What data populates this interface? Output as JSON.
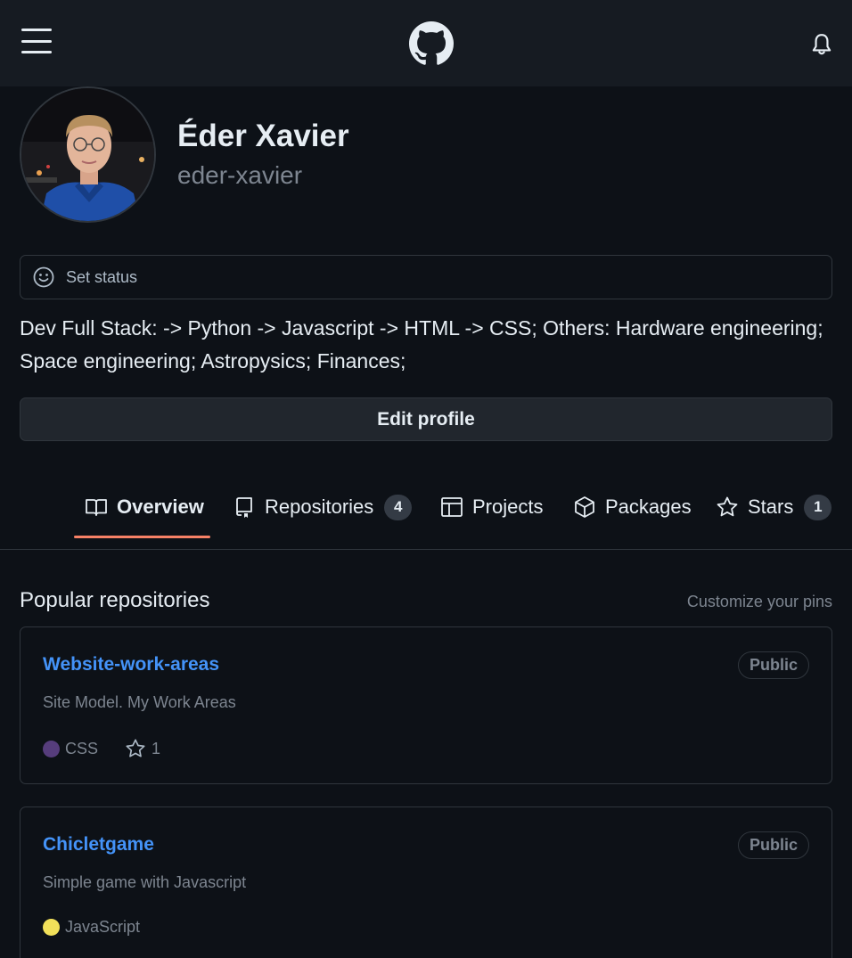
{
  "header": {
    "menu_icon": "hamburger-menu-icon",
    "logo_icon": "github-logo-icon",
    "notifications_icon": "bell-icon"
  },
  "profile": {
    "full_name": "Éder Xavier",
    "username": "eder-xavier",
    "status_label": "Set status",
    "status_icon": "smiley-icon",
    "bio": "Dev Full Stack: -> Python -> Javascript -> HTML -> CSS; Others: Hardware engineering; Space engineering; Astropysics; Finances;",
    "edit_label": "Edit profile"
  },
  "tabs": [
    {
      "label": "Overview",
      "icon": "book-icon",
      "active": true
    },
    {
      "label": "Repositories",
      "icon": "repo-icon",
      "count": "4"
    },
    {
      "label": "Projects",
      "icon": "table-icon"
    },
    {
      "label": "Packages",
      "icon": "package-icon"
    },
    {
      "label": "Stars",
      "icon": "star-icon",
      "count": "1"
    }
  ],
  "popular": {
    "title": "Popular repositories",
    "customize_label": "Customize your pins",
    "repos": [
      {
        "name": "Website-work-areas",
        "visibility": "Public",
        "description": "Site Model. My Work Areas",
        "language": "CSS",
        "language_color": "#563d7c",
        "stars": "1"
      },
      {
        "name": "Chicletgame",
        "visibility": "Public",
        "description": "Simple game with Javascript",
        "language": "JavaScript",
        "language_color": "#f1e05a"
      }
    ]
  },
  "colors": {
    "background": "#0d1117",
    "header": "#161b22",
    "link": "#4493f8",
    "active_tab_underline": "#f78166"
  }
}
